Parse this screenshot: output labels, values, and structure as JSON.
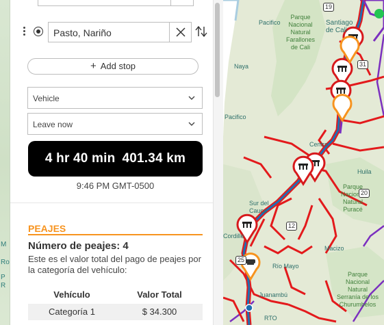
{
  "left_map": {
    "labels": [
      "M",
      "Ro",
      "P",
      "R"
    ]
  },
  "stop": {
    "value": "Pasto, Nariño"
  },
  "add_stop": {
    "label": "Add stop"
  },
  "vehicle": {
    "selected": "Vehicle"
  },
  "depart": {
    "selected": "Leave now"
  },
  "route": {
    "duration": "4 hr 40 min",
    "distance": "401.34 km",
    "arrival": "9:46 PM GMT-0500"
  },
  "tolls": {
    "section_title": "PEAJES",
    "count": "Número de peajes: 4",
    "description": "Este es el valor total del pago de peajes por la categoría del vehículo:",
    "headers": [
      "Vehículo",
      "Valor Total"
    ],
    "rows": [
      [
        "Categoría 1",
        "$ 34.300"
      ]
    ]
  },
  "map": {
    "labels": {
      "pacifico_top": "Pacifico",
      "farallones": "Parque\nNacional\nNatural\nFarallones\nde Cali",
      "santiago": "Santiago\nde Cali",
      "naya": "Naya",
      "pacifico_mid": "Pacifico",
      "centro": "Centro",
      "huila": "Huila",
      "sur_cauca": "Sur del\nCauca",
      "purace": "Parque\nNacional\nNatural\nPuracé",
      "cordillera": "Cordille",
      "rio_mayo": "Río Mayo",
      "macizo": "Macizo",
      "juanambu": "Juanambú",
      "churumbelos": "Parque\nNacional\nNatural\nSerranía de los\nChurumbelos",
      "rto": "RTO"
    },
    "road_numbers": [
      "19",
      "31",
      "20",
      "12",
      "25"
    ],
    "colors": {
      "route": "#1f6fb2",
      "traffic": "#e31a1c",
      "toll_pin": "#d7191c",
      "rest_pin": "#f7931e",
      "secondary": "#7b2fbf"
    }
  }
}
